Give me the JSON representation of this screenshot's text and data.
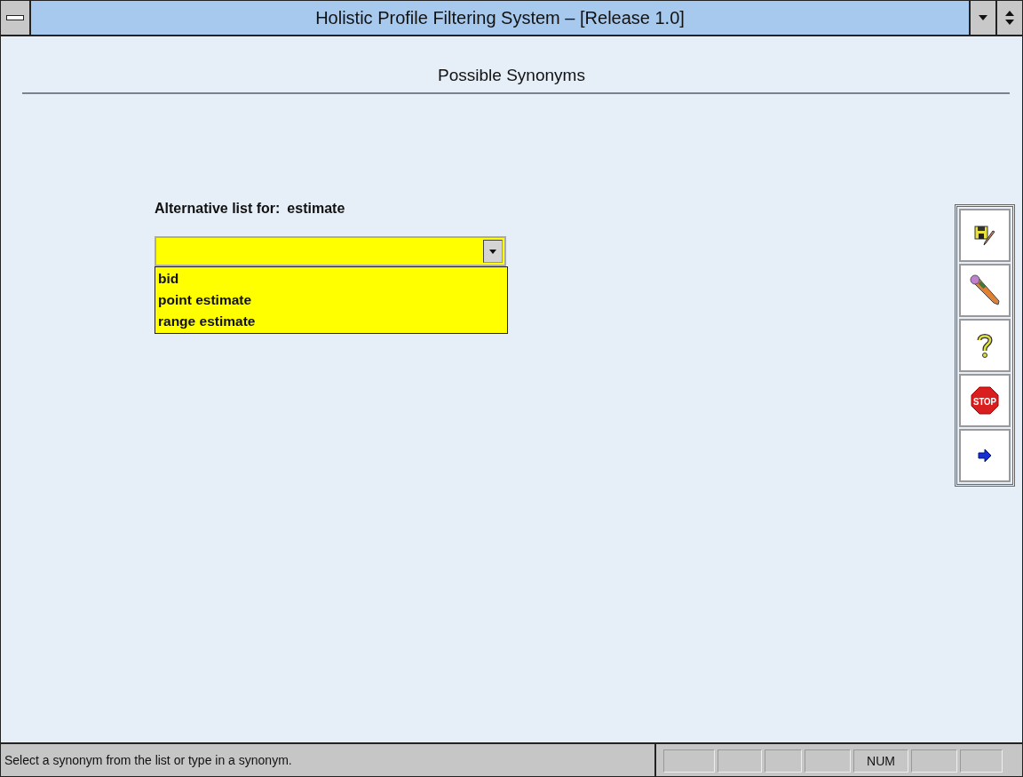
{
  "window": {
    "title": "Holistic Profile Filtering System – [Release 1.0]"
  },
  "page_title": "Possible Synonyms",
  "prompt": {
    "label": "Alternative list for:",
    "term": "estimate"
  },
  "combo": {
    "expanded": true,
    "options": [
      {
        "label": "bid"
      },
      {
        "label": "point estimate"
      },
      {
        "label": "range estimate"
      }
    ]
  },
  "toolbar": [
    {
      "kind": "save"
    },
    {
      "kind": "pencil"
    },
    {
      "kind": "help"
    },
    {
      "kind": "stop",
      "label": "STOP"
    },
    {
      "kind": "next"
    }
  ],
  "status_bar": {
    "message": "Select a synonym from the list or type in a synonym.",
    "num_lock": "NUM"
  }
}
